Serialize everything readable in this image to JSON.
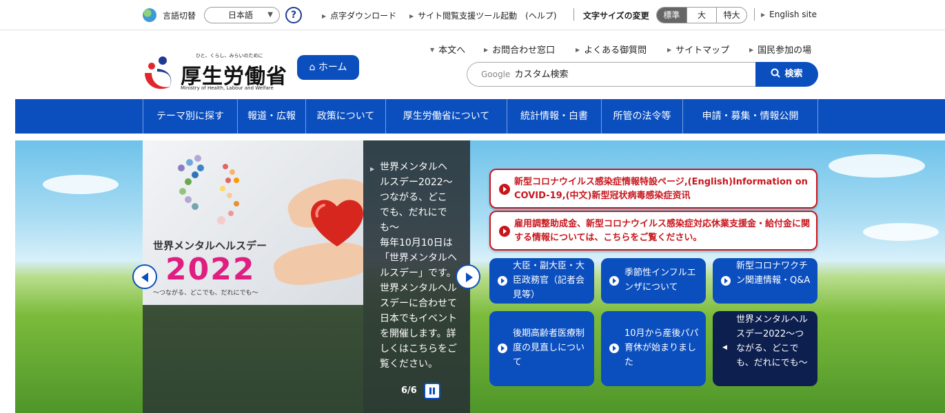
{
  "utility": {
    "lang_label": "言語切替",
    "lang_value": "日本語",
    "help_icon": "?",
    "links": [
      "点字ダウンロード",
      "サイト閲覧支援ツール起動　(ヘルプ)"
    ],
    "font_size_label": "文字サイズの変更",
    "font_sizes": [
      "標準",
      "大",
      "特大"
    ],
    "english": "English site"
  },
  "header": {
    "tagline": "ひと、くらし、みらいのために",
    "logo_title": "厚生労働省",
    "logo_sub": "Ministry of Health, Labour and Welfare",
    "home_label": "ホーム",
    "links": [
      "本文へ",
      "お問合わせ窓口",
      "よくある御質問",
      "サイトマップ",
      "国民参加の場"
    ],
    "search_google": "Google",
    "search_placeholder": "カスタム検索",
    "search_button": "検索"
  },
  "nav": [
    "テーマ別に探す",
    "報道・広報",
    "政策について",
    "厚生労働省について",
    "統計情報・白書",
    "所管の法令等",
    "申請・募集・情報公開"
  ],
  "slide": {
    "image_title": "世界メンタルヘルスデー",
    "image_year": "2022",
    "image_sub": "〜つながる、どこでも、だれにでも〜",
    "title": "世界メンタルヘルスデー2022〜つながる、どこでも、だれにでも〜",
    "body": "毎年10月10日は「世界メンタルヘルスデー」です。世界メンタルヘルスデーに合わせて日本でもイベントを開催します。詳しくはこちらをご覧ください。",
    "counter": "6/6"
  },
  "alerts": [
    "新型コロナウイルス感染症情報特設ページ,(English)Information on COVID-19,(中文)新型冠状病毒感染症资讯",
    "雇用調整助成金、新型コロナウイルス感染症対応休業支援金・給付金に関する情報については、こちらをご覧ください。"
  ],
  "tiles": [
    "大臣・副大臣・大臣政務官（記者会見等）",
    "季節性インフルエンザについて",
    "新型コロナワクチン関連情報・Q&A",
    "後期高齢者医療制度の見直しについて",
    "10月から産後パパ育休が始まりました",
    "世界メンタルヘルスデー2022〜つながる、どこでも、だれにでも〜"
  ],
  "colors": {
    "brand_blue": "#0b4fbf",
    "alert_red": "#c8161d",
    "tile_dark": "#0d1f4f"
  },
  "icons": [
    "globe-icon",
    "help-icon",
    "home-icon",
    "search-icon",
    "prev-arrow-icon",
    "next-arrow-icon",
    "pause-icon",
    "play-circle-icon"
  ]
}
